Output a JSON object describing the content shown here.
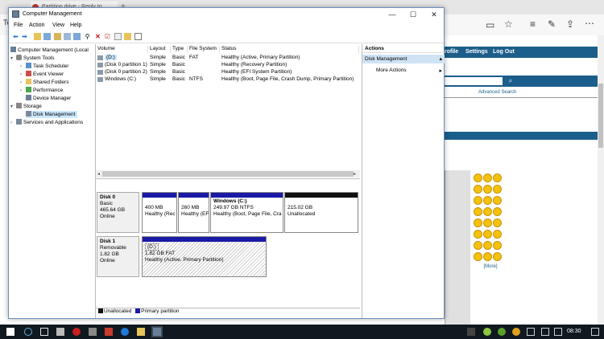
{
  "browser": {
    "tab_title": "Partition drive - Reply to",
    "new_tab": "+",
    "toolbar_partial": "To"
  },
  "web": {
    "nav_links": [
      "rofile",
      "Settings",
      "Log Out"
    ],
    "advanced_search": "Advanced Search",
    "more": "[More]"
  },
  "window": {
    "title": "Computer Management",
    "controls": {
      "minimize": "—",
      "maximize": "☐",
      "close": "✕"
    }
  },
  "menu": [
    "File",
    "Action",
    "View",
    "Help"
  ],
  "tree": [
    {
      "label": "Computer Management (Local",
      "level": 0,
      "arrow": ""
    },
    {
      "label": "System Tools",
      "level": 1,
      "arrow": "▾"
    },
    {
      "label": "Task Scheduler",
      "level": 2,
      "arrow": "›"
    },
    {
      "label": "Event Viewer",
      "level": 2,
      "arrow": "›"
    },
    {
      "label": "Shared Folders",
      "level": 2,
      "arrow": "›"
    },
    {
      "label": "Performance",
      "level": 2,
      "arrow": "›"
    },
    {
      "label": "Device Manager",
      "level": 2,
      "arrow": ""
    },
    {
      "label": "Storage",
      "level": 1,
      "arrow": "▾"
    },
    {
      "label": "Disk Management",
      "level": 2,
      "arrow": "",
      "selected": true
    },
    {
      "label": "Services and Applications",
      "level": 1,
      "arrow": "›"
    }
  ],
  "volume_table": {
    "headers": [
      "Volume",
      "Layout",
      "Type",
      "File System",
      "Status"
    ],
    "rows": [
      {
        "volume": "(D:)",
        "layout": "Simple",
        "type": "Basic",
        "fs": "FAT",
        "status": "Healthy (Active, Primary Partition)",
        "selected": true
      },
      {
        "volume": "(Disk 0 partition 1)",
        "layout": "Simple",
        "type": "Basic",
        "fs": "",
        "status": "Healthy (Recovery Partition)"
      },
      {
        "volume": "(Disk 0 partition 2)",
        "layout": "Simple",
        "type": "Basic",
        "fs": "",
        "status": "Healthy (EFI System Partition)"
      },
      {
        "volume": "Windows (C:)",
        "layout": "Simple",
        "type": "Basic",
        "fs": "NTFS",
        "status": "Healthy (Boot, Page File, Crash Dump, Primary Partition)"
      }
    ]
  },
  "disk0": {
    "name": "Disk 0",
    "type": "Basic",
    "size": "465.64 GB",
    "status": "Online",
    "partitions": [
      {
        "title": "",
        "line1": "400 MB",
        "line2": "Healthy (Rec"
      },
      {
        "title": "",
        "line1": "260 MB",
        "line2": "Healthy (EF"
      },
      {
        "title": "Windows (C:)",
        "line1": "249.97 GB NTFS",
        "line2": "Healthy (Boot, Page File, Cra"
      },
      {
        "title": "",
        "line1": "215.02 GB",
        "line2": "Unallocated"
      }
    ]
  },
  "disk1": {
    "name": "Disk 1",
    "type": "Removable",
    "size": "1.82 GB",
    "status": "Online",
    "partition": {
      "title": "(D:)",
      "line1": "1.82 GB FAT",
      "line2": "Healthy (Active, Primary Partition)"
    }
  },
  "legend": {
    "unallocated": "Unallocated",
    "primary": "Primary partition"
  },
  "actions": {
    "title": "Actions",
    "section": "Disk Management",
    "more": "More Actions"
  },
  "taskbar": {
    "time": "08:30"
  },
  "colors": {
    "primary_partition": "#1a1aa6",
    "unallocated": "#111111",
    "selection": "#cce8ff",
    "site_blue": "#1b5e8b"
  }
}
